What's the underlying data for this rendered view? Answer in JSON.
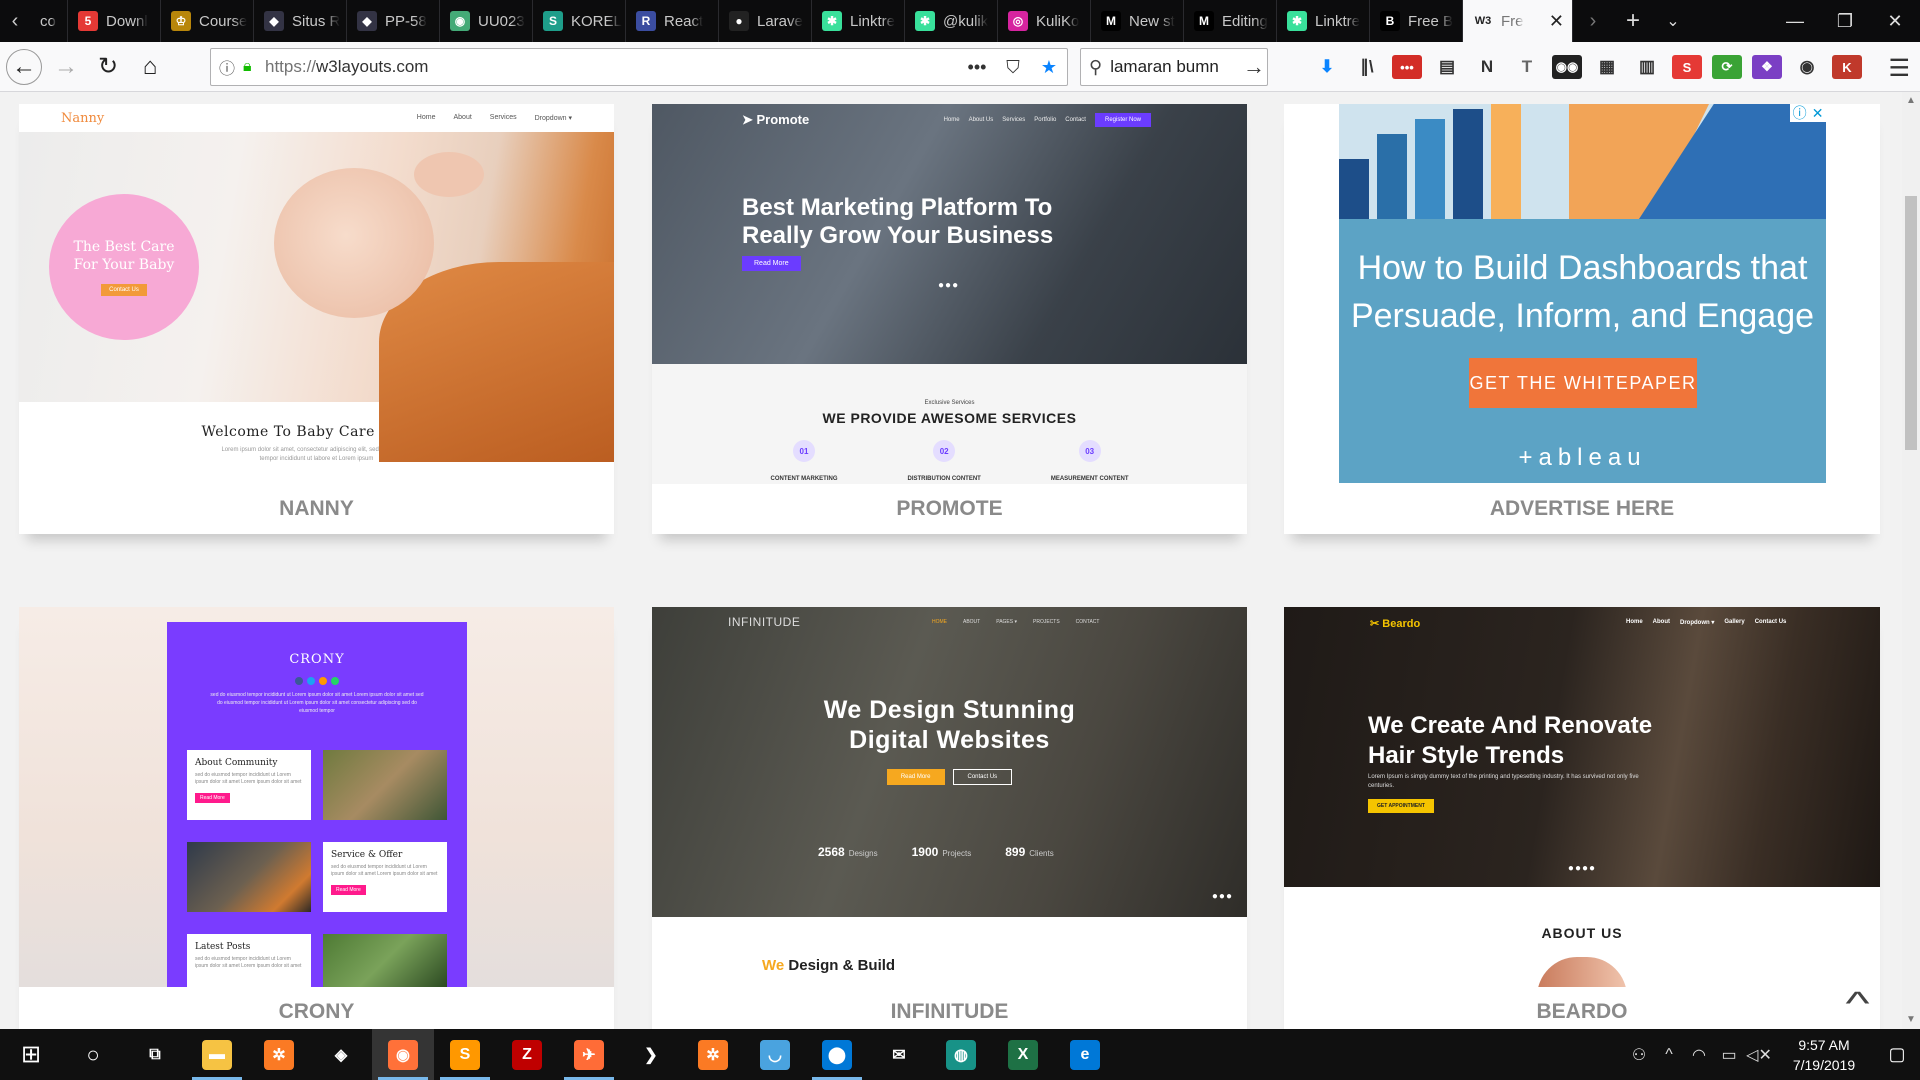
{
  "browser": {
    "tabs": [
      {
        "label": "co",
        "fav_color": "#333"
      },
      {
        "label": "Downl",
        "fav_color": "#e53935",
        "fav_glyph": "5"
      },
      {
        "label": "Course",
        "fav_color": "#b8860b",
        "fav_glyph": "♔"
      },
      {
        "label": "Situs R",
        "fav_color": "#334",
        "fav_glyph": "◆"
      },
      {
        "label": "PP-58",
        "fav_color": "#334",
        "fav_glyph": "◆"
      },
      {
        "label": "UU023",
        "fav_color": "#4a7",
        "fav_glyph": "◉"
      },
      {
        "label": "KOREL",
        "fav_color": "#1e9e8a",
        "fav_glyph": "S"
      },
      {
        "label": "React",
        "fav_color": "#3b4da0",
        "fav_glyph": "R"
      },
      {
        "label": "Larave",
        "fav_color": "#222",
        "fav_glyph": "●"
      },
      {
        "label": "Linktre",
        "fav_color": "#39e09b",
        "fav_glyph": "✱"
      },
      {
        "label": "@kulik",
        "fav_color": "#39e09b",
        "fav_glyph": "✱"
      },
      {
        "label": "KuliKo",
        "fav_color": "#d6249f",
        "fav_glyph": "◎"
      },
      {
        "label": "New st",
        "fav_color": "#000",
        "fav_glyph": "M"
      },
      {
        "label": "Editing",
        "fav_color": "#000",
        "fav_glyph": "M"
      },
      {
        "label": "Linktre",
        "fav_color": "#39e09b",
        "fav_glyph": "✱"
      },
      {
        "label": "Free B",
        "fav_color": "#000",
        "fav_glyph": "B"
      }
    ],
    "active_tab": {
      "label": "Fre",
      "fav_glyph": "W3"
    },
    "url_protocol": "https://",
    "url_host": "w3layouts.com",
    "search_value": "lamaran bumn",
    "toolbar_icons": [
      {
        "name": "download-icon",
        "glyph": "⬇",
        "color": "#0a84ff",
        "bg": "transparent"
      },
      {
        "name": "library-icon",
        "glyph": "∥\\",
        "color": "#333",
        "bg": "transparent"
      },
      {
        "name": "lastpass-icon",
        "glyph": "•••",
        "color": "#fff",
        "bg": "#d32d27"
      },
      {
        "name": "reader-icon",
        "glyph": "▤",
        "color": "#333",
        "bg": "transparent"
      },
      {
        "name": "notion-icon",
        "glyph": "N",
        "color": "#333",
        "bg": "transparent"
      },
      {
        "name": "text-icon",
        "glyph": "T",
        "color": "#666",
        "bg": "transparent"
      },
      {
        "name": "tampermonkey-icon",
        "glyph": "◉◉",
        "color": "#fff",
        "bg": "#222"
      },
      {
        "name": "grid-icon",
        "glyph": "▦",
        "color": "#333",
        "bg": "transparent"
      },
      {
        "name": "stats-icon",
        "glyph": "▥",
        "color": "#333",
        "bg": "transparent"
      },
      {
        "name": "s-extension-icon",
        "glyph": "S",
        "color": "#fff",
        "bg": "#e53935"
      },
      {
        "name": "green-extension-icon",
        "glyph": "⟳",
        "color": "#fff",
        "bg": "#3aa335"
      },
      {
        "name": "purple-extension-icon",
        "glyph": "❖",
        "color": "#fff",
        "bg": "#7b3fc4"
      },
      {
        "name": "account-icon",
        "glyph": "◉",
        "color": "#333",
        "bg": "transparent"
      },
      {
        "name": "profile-icon",
        "glyph": "K",
        "color": "#fff",
        "bg": "#c0392b"
      }
    ]
  },
  "cards": {
    "nanny": {
      "caption": "NANNY",
      "logo": "Nanny",
      "nav": [
        "Home",
        "About",
        "Services",
        "Dropdown ▾"
      ],
      "hero_text_1": "The Best Care",
      "hero_text_2": "For Your Baby",
      "hero_btn": "Contact Us",
      "welcome": "Welcome To Baby Care Center",
      "lorem_1": "Lorem ipsum dolor sit amet, consectetur adipiscing elit, sed do eiusmod",
      "lorem_2": "tempor incididunt ut labore et Lorem ipsum"
    },
    "promote": {
      "caption": "PROMOTE",
      "logo": "Promote",
      "nav": [
        "Home",
        "About Us",
        "Services",
        "Portfolio",
        "Contact"
      ],
      "register": "Register Now",
      "title_1": "Best Marketing Platform To",
      "title_2": "Really Grow Your Business",
      "read_more": "Read More",
      "sub": "Exclusive Services",
      "heading": "WE PROVIDE AWESOME SERVICES",
      "features": [
        {
          "num": "01",
          "label": "CONTENT MARKETING"
        },
        {
          "num": "02",
          "label": "DISTRIBUTION CONTENT"
        },
        {
          "num": "03",
          "label": "MEASUREMENT CONTENT"
        }
      ]
    },
    "ad": {
      "caption": "ADVERTISE HERE",
      "title_1": "How to Build Dashboards that",
      "title_2": "Persuade, Inform, and Engage",
      "cta": "GET THE WHITEPAPER",
      "brand": "+ableau",
      "colors": {
        "bg": "#5ca3c5",
        "cta": "#f0753a"
      }
    },
    "crony": {
      "caption": "CRONY",
      "title": "CRONY",
      "intro": "sed do eiusmod tempor incididunt ut Lorem ipsum dolor sit amet Lorem ipsum dolor sit amet sed do eiusmod tempor incididunt ut Lorem ipsum dolor sit amet consectetur adipiscing sed do eiusmod tempor",
      "box_1_title": "About Community",
      "box_2_title": "Service & Offer",
      "box_3_title": "Latest Posts",
      "box_text": "sed do eiusmod tempor incididunt ut Lorem ipsum dolor sit amet Lorem ipsum dolor sit amet",
      "btn": "Read More"
    },
    "infinitude": {
      "caption": "INFINITUDE",
      "logo": "INFINITUDE",
      "nav": [
        "HOME",
        "ABOUT",
        "PAGES ▾",
        "PROJECTS",
        "CONTACT"
      ],
      "title_1": "We Design Stunning",
      "title_2": "Digital Websites",
      "btn_1": "Read More",
      "btn_2": "Contact Us",
      "stats": [
        {
          "value": "2568",
          "label": "Designs"
        },
        {
          "value": "1900",
          "label": "Projects"
        },
        {
          "value": "899",
          "label": "Clients"
        }
      ],
      "body_we": "We",
      "body_rest": "Design & Build"
    },
    "beardo": {
      "caption": "BEARDO",
      "logo": "✂ Beardo",
      "nav": [
        "Home",
        "About",
        "Dropdown ▾",
        "Gallery",
        "Contact Us"
      ],
      "title_1": "We Create And Renovate",
      "title_2": "Hair Style Trends",
      "sub": "Lorem Ipsum is simply dummy text of the printing and typesetting industry. It has survived not only five centuries.",
      "btn": "GET APPOINTMENT",
      "about": "ABOUT US"
    }
  },
  "taskbar": {
    "apps": [
      {
        "name": "task-view-icon",
        "glyph": "⧉",
        "bg": "transparent"
      },
      {
        "name": "file-explorer-icon",
        "glyph": "▬",
        "bg": "#f6c343"
      },
      {
        "name": "xampp-icon",
        "glyph": "✲",
        "bg": "#fb7a24"
      },
      {
        "name": "chrome-icon",
        "glyph": "◈",
        "bg": "transparent"
      },
      {
        "name": "firefox-icon",
        "glyph": "◉",
        "bg": "#ff7139"
      },
      {
        "name": "sublime-icon",
        "glyph": "S",
        "bg": "#ff9800"
      },
      {
        "name": "filezilla-icon",
        "glyph": "Z",
        "bg": "#bf0000"
      },
      {
        "name": "postman-icon",
        "glyph": "✈",
        "bg": "#ff6c37"
      },
      {
        "name": "dolphin-icon",
        "glyph": "❯",
        "bg": "transparent"
      },
      {
        "name": "xampp-control-icon",
        "glyph": "✲",
        "bg": "#fb7a24"
      },
      {
        "name": "store-icon",
        "glyph": "◡",
        "bg": "#4aa3df"
      },
      {
        "name": "maps-icon",
        "glyph": "⬤",
        "bg": "#0078d7"
      },
      {
        "name": "mail-icon",
        "glyph": "✉",
        "bg": "transparent"
      },
      {
        "name": "gitkraken-icon",
        "glyph": "◍",
        "bg": "#179287"
      },
      {
        "name": "excel-icon",
        "glyph": "X",
        "bg": "#1e7145"
      },
      {
        "name": "edge-icon",
        "glyph": "e",
        "bg": "#0078d7"
      }
    ],
    "time": "9:57 AM",
    "date": "7/19/2019"
  }
}
